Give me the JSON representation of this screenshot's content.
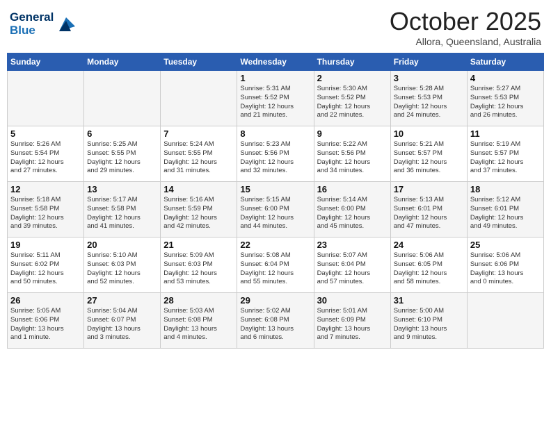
{
  "header": {
    "logo_line1": "General",
    "logo_line2": "Blue",
    "month": "October 2025",
    "location": "Allora, Queensland, Australia"
  },
  "days_of_week": [
    "Sunday",
    "Monday",
    "Tuesday",
    "Wednesday",
    "Thursday",
    "Friday",
    "Saturday"
  ],
  "weeks": [
    [
      {
        "day": "",
        "info": ""
      },
      {
        "day": "",
        "info": ""
      },
      {
        "day": "",
        "info": ""
      },
      {
        "day": "1",
        "info": "Sunrise: 5:31 AM\nSunset: 5:52 PM\nDaylight: 12 hours\nand 21 minutes."
      },
      {
        "day": "2",
        "info": "Sunrise: 5:30 AM\nSunset: 5:52 PM\nDaylight: 12 hours\nand 22 minutes."
      },
      {
        "day": "3",
        "info": "Sunrise: 5:28 AM\nSunset: 5:53 PM\nDaylight: 12 hours\nand 24 minutes."
      },
      {
        "day": "4",
        "info": "Sunrise: 5:27 AM\nSunset: 5:53 PM\nDaylight: 12 hours\nand 26 minutes."
      }
    ],
    [
      {
        "day": "5",
        "info": "Sunrise: 5:26 AM\nSunset: 5:54 PM\nDaylight: 12 hours\nand 27 minutes."
      },
      {
        "day": "6",
        "info": "Sunrise: 5:25 AM\nSunset: 5:55 PM\nDaylight: 12 hours\nand 29 minutes."
      },
      {
        "day": "7",
        "info": "Sunrise: 5:24 AM\nSunset: 5:55 PM\nDaylight: 12 hours\nand 31 minutes."
      },
      {
        "day": "8",
        "info": "Sunrise: 5:23 AM\nSunset: 5:56 PM\nDaylight: 12 hours\nand 32 minutes."
      },
      {
        "day": "9",
        "info": "Sunrise: 5:22 AM\nSunset: 5:56 PM\nDaylight: 12 hours\nand 34 minutes."
      },
      {
        "day": "10",
        "info": "Sunrise: 5:21 AM\nSunset: 5:57 PM\nDaylight: 12 hours\nand 36 minutes."
      },
      {
        "day": "11",
        "info": "Sunrise: 5:19 AM\nSunset: 5:57 PM\nDaylight: 12 hours\nand 37 minutes."
      }
    ],
    [
      {
        "day": "12",
        "info": "Sunrise: 5:18 AM\nSunset: 5:58 PM\nDaylight: 12 hours\nand 39 minutes."
      },
      {
        "day": "13",
        "info": "Sunrise: 5:17 AM\nSunset: 5:58 PM\nDaylight: 12 hours\nand 41 minutes."
      },
      {
        "day": "14",
        "info": "Sunrise: 5:16 AM\nSunset: 5:59 PM\nDaylight: 12 hours\nand 42 minutes."
      },
      {
        "day": "15",
        "info": "Sunrise: 5:15 AM\nSunset: 6:00 PM\nDaylight: 12 hours\nand 44 minutes."
      },
      {
        "day": "16",
        "info": "Sunrise: 5:14 AM\nSunset: 6:00 PM\nDaylight: 12 hours\nand 45 minutes."
      },
      {
        "day": "17",
        "info": "Sunrise: 5:13 AM\nSunset: 6:01 PM\nDaylight: 12 hours\nand 47 minutes."
      },
      {
        "day": "18",
        "info": "Sunrise: 5:12 AM\nSunset: 6:01 PM\nDaylight: 12 hours\nand 49 minutes."
      }
    ],
    [
      {
        "day": "19",
        "info": "Sunrise: 5:11 AM\nSunset: 6:02 PM\nDaylight: 12 hours\nand 50 minutes."
      },
      {
        "day": "20",
        "info": "Sunrise: 5:10 AM\nSunset: 6:03 PM\nDaylight: 12 hours\nand 52 minutes."
      },
      {
        "day": "21",
        "info": "Sunrise: 5:09 AM\nSunset: 6:03 PM\nDaylight: 12 hours\nand 53 minutes."
      },
      {
        "day": "22",
        "info": "Sunrise: 5:08 AM\nSunset: 6:04 PM\nDaylight: 12 hours\nand 55 minutes."
      },
      {
        "day": "23",
        "info": "Sunrise: 5:07 AM\nSunset: 6:04 PM\nDaylight: 12 hours\nand 57 minutes."
      },
      {
        "day": "24",
        "info": "Sunrise: 5:06 AM\nSunset: 6:05 PM\nDaylight: 12 hours\nand 58 minutes."
      },
      {
        "day": "25",
        "info": "Sunrise: 5:06 AM\nSunset: 6:06 PM\nDaylight: 13 hours\nand 0 minutes."
      }
    ],
    [
      {
        "day": "26",
        "info": "Sunrise: 5:05 AM\nSunset: 6:06 PM\nDaylight: 13 hours\nand 1 minute."
      },
      {
        "day": "27",
        "info": "Sunrise: 5:04 AM\nSunset: 6:07 PM\nDaylight: 13 hours\nand 3 minutes."
      },
      {
        "day": "28",
        "info": "Sunrise: 5:03 AM\nSunset: 6:08 PM\nDaylight: 13 hours\nand 4 minutes."
      },
      {
        "day": "29",
        "info": "Sunrise: 5:02 AM\nSunset: 6:08 PM\nDaylight: 13 hours\nand 6 minutes."
      },
      {
        "day": "30",
        "info": "Sunrise: 5:01 AM\nSunset: 6:09 PM\nDaylight: 13 hours\nand 7 minutes."
      },
      {
        "day": "31",
        "info": "Sunrise: 5:00 AM\nSunset: 6:10 PM\nDaylight: 13 hours\nand 9 minutes."
      },
      {
        "day": "",
        "info": ""
      }
    ]
  ]
}
